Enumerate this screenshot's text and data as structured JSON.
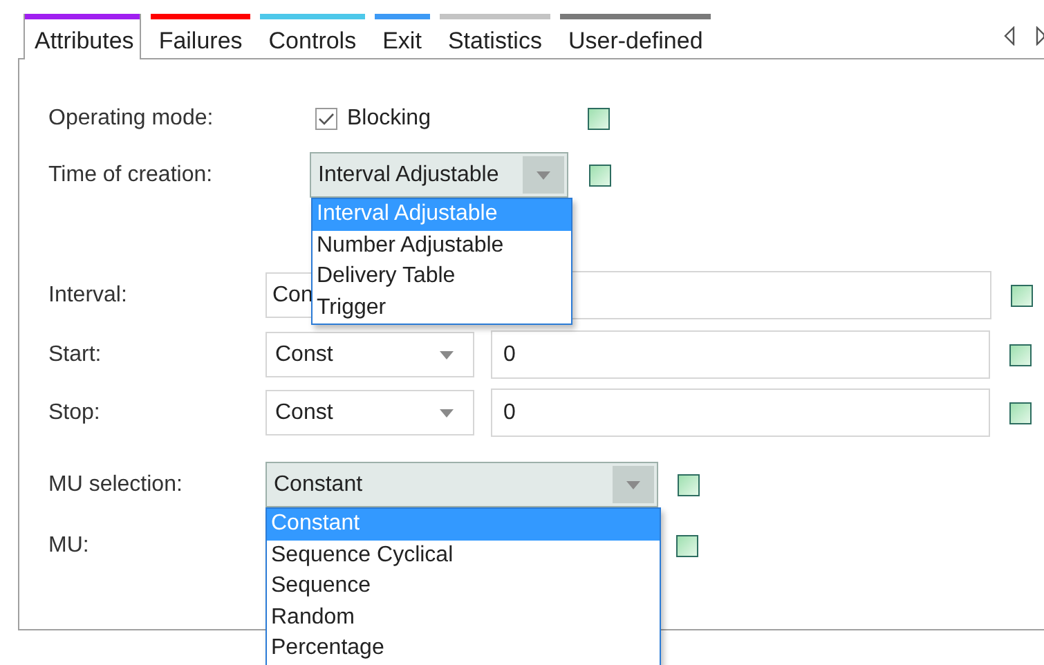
{
  "tabs": [
    {
      "label": "Attributes",
      "color": "#a01ff0",
      "selected": true
    },
    {
      "label": "Failures",
      "color": "#ff0000",
      "selected": false
    },
    {
      "label": "Controls",
      "color": "#4dc8ea",
      "selected": false
    },
    {
      "label": "Exit",
      "color": "#3d9af5",
      "selected": false
    },
    {
      "label": "Statistics",
      "color": "#c4c4c4",
      "selected": false
    },
    {
      "label": "User-defined",
      "color": "#7a7a7a",
      "selected": false
    }
  ],
  "fields": [
    {
      "kind": "checkbox",
      "label": "Operating mode:",
      "option": "Blocking",
      "checked": true
    },
    {
      "kind": "combo",
      "label": "Time of creation:",
      "value": "Interval Adjustable",
      "dropdown": [
        {
          "label": "Interval Adjustable",
          "selected": true
        },
        {
          "label": "Number Adjustable",
          "selected": false
        },
        {
          "label": "Delivery Table",
          "selected": false
        },
        {
          "label": "Trigger",
          "selected": false
        }
      ]
    },
    {
      "kind": "formula",
      "label": "Interval:",
      "mode": "Con",
      "dropdown_arrow": false
    },
    {
      "kind": "formula",
      "label": "Start:",
      "mode": "Const",
      "value": "0",
      "dropdown_arrow": true
    },
    {
      "kind": "formula",
      "label": "Stop:",
      "mode": "Const",
      "value": "0",
      "dropdown_arrow": true
    },
    {
      "kind": "combo",
      "label": "MU selection:",
      "value": "Constant",
      "dropdown": [
        {
          "label": "Constant",
          "selected": true
        },
        {
          "label": "Sequence Cyclical",
          "selected": false
        },
        {
          "label": "Sequence",
          "selected": false
        },
        {
          "label": "Random",
          "selected": false
        },
        {
          "label": "Percentage",
          "selected": false
        }
      ]
    },
    {
      "kind": "plain",
      "label": "MU:"
    }
  ]
}
